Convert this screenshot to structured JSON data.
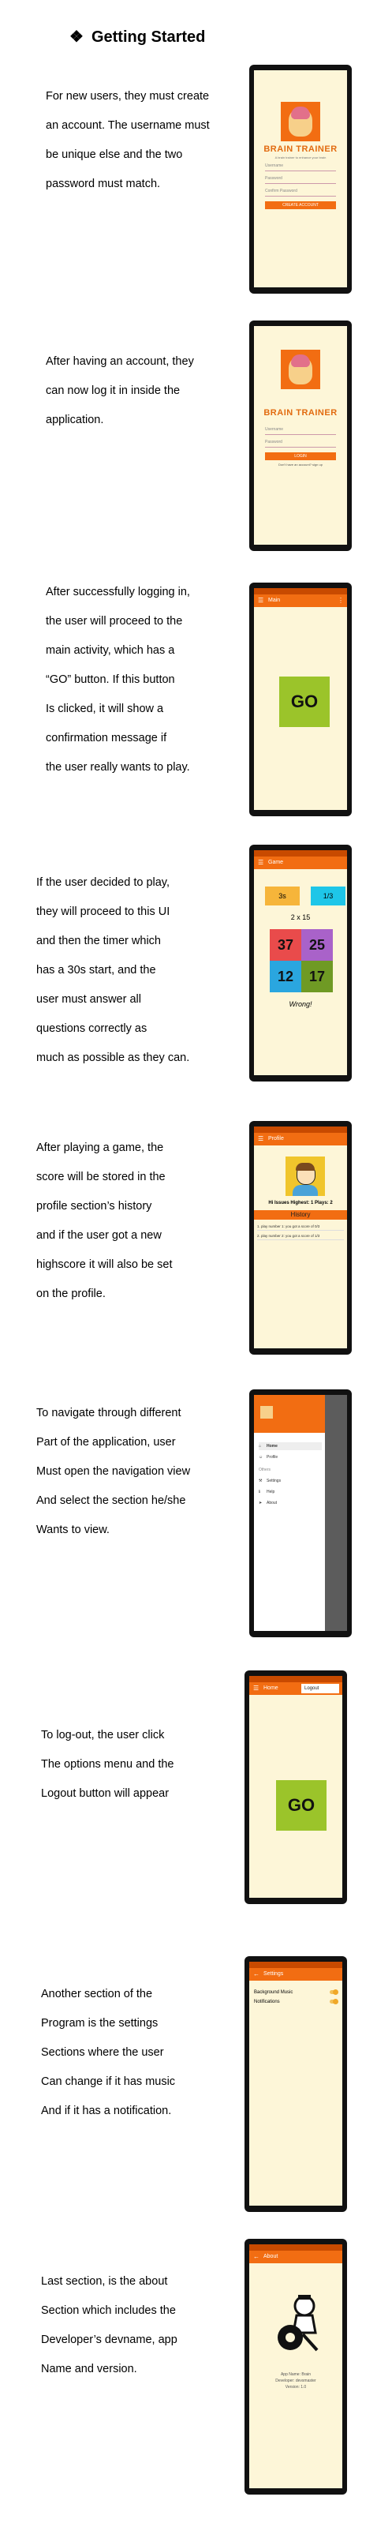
{
  "heading": {
    "bullet": "❖",
    "text": "Getting Started"
  },
  "sections": [
    {
      "lines": [
        "For new users, they must create",
        "an account. The username must",
        "be unique else and the two",
        "password must match."
      ]
    },
    {
      "lines": [
        "After having an account, they",
        "can now log it in inside the",
        "application."
      ]
    },
    {
      "lines": [
        "After successfully logging in,",
        "the user will proceed to the",
        "main activity, which has a",
        "“GO” button. If this button",
        "Is clicked, it will show a",
        "confirmation message if",
        "the user really wants to play."
      ]
    },
    {
      "lines": [
        "If the user decided to play,",
        "they will proceed to this UI",
        "and then the timer which",
        "has a 30s start, and the",
        "user must answer all",
        "questions correctly as",
        "much as possible as they can."
      ]
    },
    {
      "lines": [
        "After playing a game, the",
        "score will be stored in the",
        "profile section’s history",
        "and if the user got a new",
        "highscore it will also be set",
        "on the profile."
      ]
    },
    {
      "lines": [
        "To navigate through different",
        "Part of the application, user",
        "Must open the navigation view",
        "And select the section he/she",
        "Wants to view."
      ]
    },
    {
      "lines": [
        "To log-out, the user click",
        "The options menu and the",
        "Logout button will appear"
      ]
    },
    {
      "lines": [
        "Another section of the",
        "Program is the settings",
        "Sections where the user",
        "Can change if it has music",
        "And if it has a notification."
      ]
    },
    {
      "lines": [
        "Last section, is the about",
        "Section which includes the",
        "Developer’s devname, app",
        "Name and version."
      ]
    }
  ],
  "screens": {
    "register": {
      "brand": "BRAIN TRAINER",
      "tagline": "A brain trainer to enhance your brain",
      "username_placeholder": "Username",
      "password_placeholder": "Password",
      "confirm_placeholder": "Confirm Password",
      "button": "CREATE ACCOUNT"
    },
    "login": {
      "brand": "BRAIN TRAINER",
      "username_placeholder": "Username",
      "password_placeholder": "Password",
      "button": "LOGIN",
      "link": "Don't have an account? sign up"
    },
    "main": {
      "appbar_title": "Main",
      "go": "GO"
    },
    "game": {
      "appbar_title": "Game",
      "timer": "3s",
      "score": "1/3",
      "question": "2 x 15",
      "answers": [
        "37",
        "25",
        "12",
        "17"
      ],
      "result": "Wrong!",
      "colors": {
        "timer": "#f6b53a",
        "score": "#1ec6e8",
        "a1": "#e94b4b",
        "a2": "#a962c9",
        "a3": "#2aa6df",
        "a4": "#6f9a24"
      }
    },
    "profile": {
      "appbar_title": "Profile",
      "stats": "Hi Issues   Highest: 1   Plays: 2",
      "history_label": "History",
      "history": [
        "1. play number 1: you got a score of 0/3",
        "2. play number 2: you got a score of 1/3"
      ]
    },
    "drawer": {
      "items": [
        {
          "icon": "⌂",
          "label": "Home"
        },
        {
          "icon": "☺",
          "label": "Profile"
        },
        {
          "icon": "",
          "label": "Others"
        },
        {
          "icon": "⚒",
          "label": "Settings"
        },
        {
          "icon": "ℹ",
          "label": "Help"
        },
        {
          "icon": "➤",
          "label": "About"
        }
      ]
    },
    "logout": {
      "appbar_title": "Home",
      "menu_item": "Logout",
      "go": "GO"
    },
    "settings": {
      "appbar_title": "Settings",
      "rows": [
        "Background Music",
        "Notifications"
      ]
    },
    "about": {
      "appbar_title": "About",
      "lines": [
        "App Name: Brain",
        "Developer: devsmaster",
        "Version: 1.0"
      ]
    }
  },
  "colors": {
    "accent": "#f26d12",
    "screen_bg": "#fdf6d8",
    "go_bg": "#9bc42a"
  }
}
